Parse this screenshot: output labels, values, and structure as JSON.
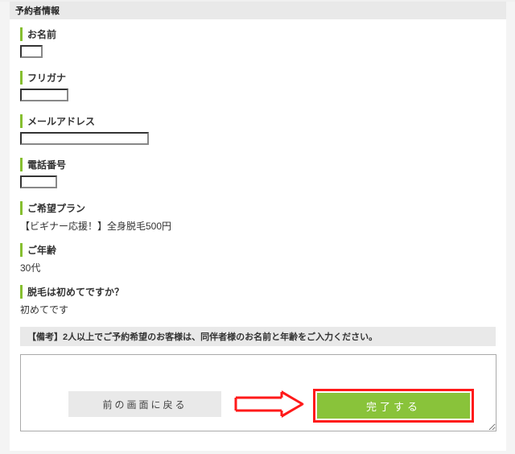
{
  "section_title": "予約者情報",
  "fields": {
    "name": {
      "label": "お名前"
    },
    "kana": {
      "label": "フリガナ"
    },
    "email": {
      "label": "メールアドレス"
    },
    "phone": {
      "label": "電話番号"
    },
    "plan": {
      "label": "ご希望プラン",
      "value": "【ビギナー応援！】全身脱毛500円"
    },
    "age": {
      "label": "ご年齢",
      "value": "30代"
    },
    "first": {
      "label": "脱毛は初めてですか？",
      "value": "初めてです"
    }
  },
  "remarks_header": "【備考】2人以上でご予約希望のお客様は、同伴者様のお名前と年齢をご入力ください。",
  "buttons": {
    "back": "前の画面に戻る",
    "done": "完了する"
  }
}
